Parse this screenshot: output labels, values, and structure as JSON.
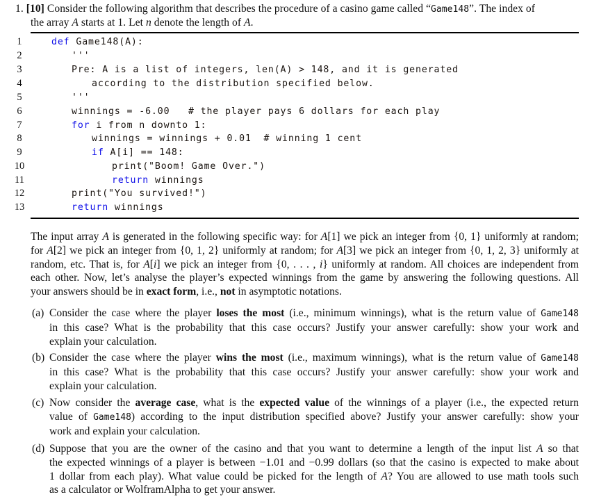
{
  "question": {
    "number": "1.",
    "points": "[10]",
    "intro_lines": [
      "Consider the following algorithm that describes the procedure of a casino game called “Game148”. The index of",
      "the array A starts at 1. Let n denote the length of A."
    ]
  },
  "code": {
    "line_numbers": [
      "1",
      "2",
      "3",
      "4",
      "5",
      "6",
      "7",
      "8",
      "9",
      "10",
      "11",
      "12",
      "13"
    ],
    "lines": [
      {
        "indent": 0,
        "kw": "def",
        "rest": " Game148(A):"
      },
      {
        "indent": 1,
        "kw": "",
        "rest": "'''"
      },
      {
        "indent": 1,
        "kw": "",
        "rest": "Pre: A is a list of integers, len(A) > 148, and it is generated"
      },
      {
        "indent": 2,
        "kw": "",
        "rest": "according to the distribution specified below."
      },
      {
        "indent": 1,
        "kw": "",
        "rest": "'''"
      },
      {
        "indent": 1,
        "kw": "",
        "rest": "winnings = -6.00   # the player pays 6 dollars for each play"
      },
      {
        "indent": 1,
        "kw": "for",
        "rest": " i from n downto 1:"
      },
      {
        "indent": 2,
        "kw": "",
        "rest": "winnings = winnings + 0.01  # winning 1 cent"
      },
      {
        "indent": 2,
        "kw": "if",
        "rest": " A[i] == 148:"
      },
      {
        "indent": 3,
        "kw": "",
        "rest": "print(\"Boom! Game Over.\")"
      },
      {
        "indent": 3,
        "kw": "return",
        "rest": " winnings"
      },
      {
        "indent": 1,
        "kw": "",
        "rest": "print(\"You survived!\")"
      },
      {
        "indent": 1,
        "kw": "return",
        "rest": " winnings"
      }
    ]
  },
  "description": {
    "lines": [
      "The input array A is generated in the following specific way: for A[1] we pick an integer from {0, 1} uniformly at random;",
      "for A[2] we pick an integer from {0, 1, 2} uniformly at random; for A[3] we pick an integer from {0, 1, 2, 3} uniformly at",
      "random, etc. That is, for A[i] we pick an integer from {0, . . . , i} uniformly at random. All choices are independent from",
      "each other. Now, let’s analyse the player’s expected winnings from the game by answering the following questions. All",
      "your answers should be in exact form, i.e., not in asymptotic notations."
    ]
  },
  "parts": [
    {
      "label": "(a)",
      "lines": [
        "Consider the case where the player loses the most (i.e., minimum winnings), what is the return value of Game148",
        "in this case? What is the probability that this case occurs? Justify your answer carefully: show your work and",
        "explain your calculation."
      ]
    },
    {
      "label": "(b)",
      "lines": [
        "Consider the case where the player wins the most (i.e., maximum winnings), what is the return value of Game148",
        "in this case? What is the probability that this case occurs? Justify your answer carefully: show your work and",
        "explain your calculation."
      ]
    },
    {
      "label": "(c)",
      "lines": [
        "Now consider the average case, what is the expected value of the winnings of a player (i.e., the expected return",
        "value of Game148) according to the input distribution specified above? Justify your answer carefully: show your",
        "work and explain your calculation."
      ]
    },
    {
      "label": "(d)",
      "lines": [
        "Suppose that you are the owner of the casino and that you want to determine a length of the input list A so that",
        "the expected winnings of a player is between −1.01 and −0.99 dollars (so that the casino is expected to make about",
        "1 dollar from each play). What value could be picked for the length of A? You are allowed to use math tools such",
        "as a calculator or WolframAlpha to get your answer."
      ]
    }
  ],
  "colors": {
    "keyword": "#1010e8",
    "code_text": "#1a1410",
    "text": "#111111"
  }
}
